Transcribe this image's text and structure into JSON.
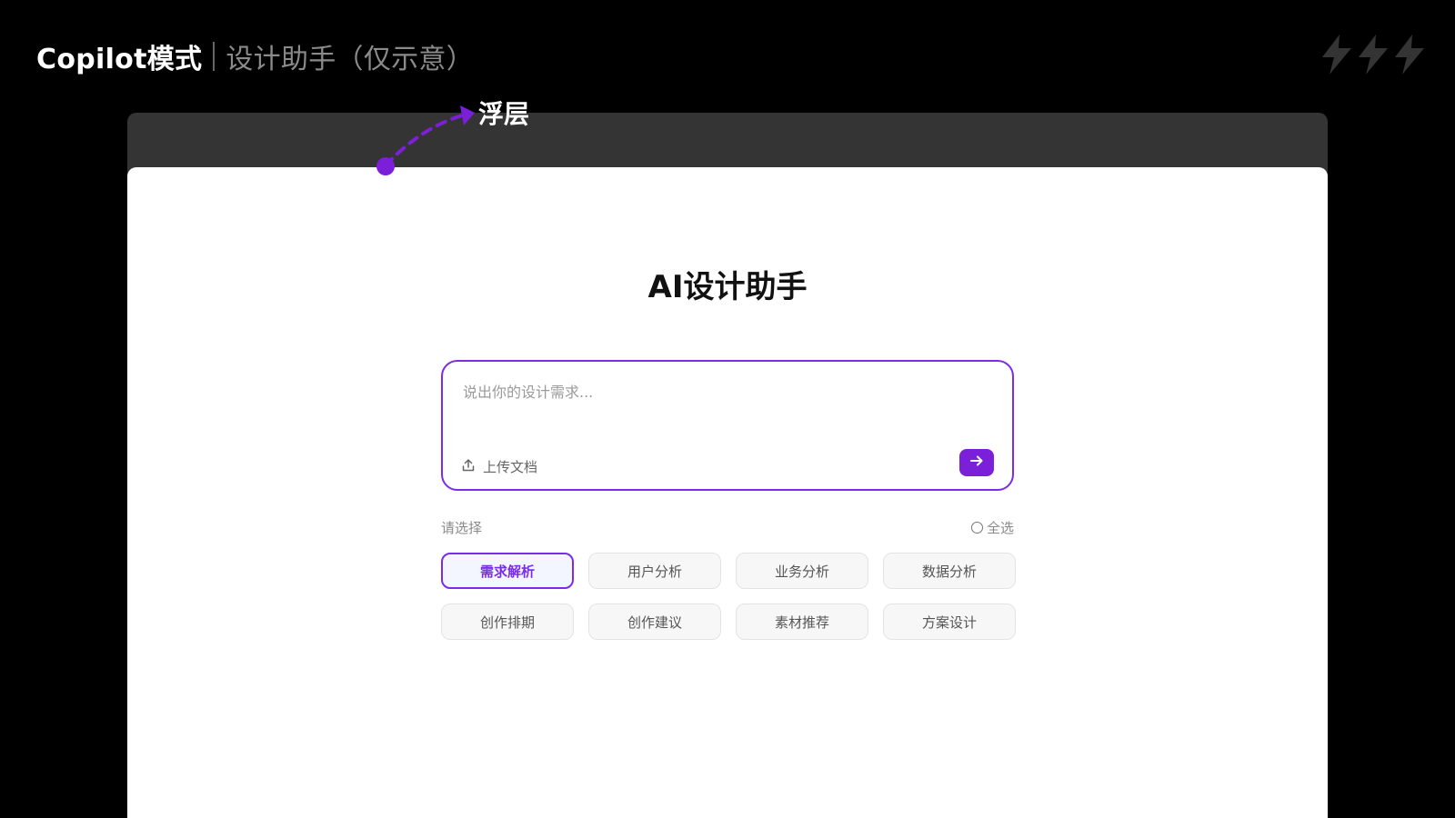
{
  "header": {
    "title": "Copilot模式",
    "subtitle": "设计助手（仅示意）"
  },
  "annotation": {
    "label": "浮层",
    "color": "#7b1fd8"
  },
  "panel": {
    "title": "AI设计助手",
    "input": {
      "placeholder": "说出你的设计需求...",
      "value": "",
      "upload_label": "上传文档",
      "send_icon": "arrow-right-icon"
    },
    "select_label": "请选择",
    "select_all_label": "全选",
    "chips": [
      {
        "label": "需求解析",
        "selected": true
      },
      {
        "label": "用户分析",
        "selected": false
      },
      {
        "label": "业务分析",
        "selected": false
      },
      {
        "label": "数据分析",
        "selected": false
      },
      {
        "label": "创作排期",
        "selected": false
      },
      {
        "label": "创作建议",
        "selected": false
      },
      {
        "label": "素材推荐",
        "selected": false
      },
      {
        "label": "方案设计",
        "selected": false
      }
    ]
  },
  "colors": {
    "accent": "#7b1fd8",
    "background": "#000000",
    "panel": "#ffffff",
    "bolt": "#343434"
  }
}
